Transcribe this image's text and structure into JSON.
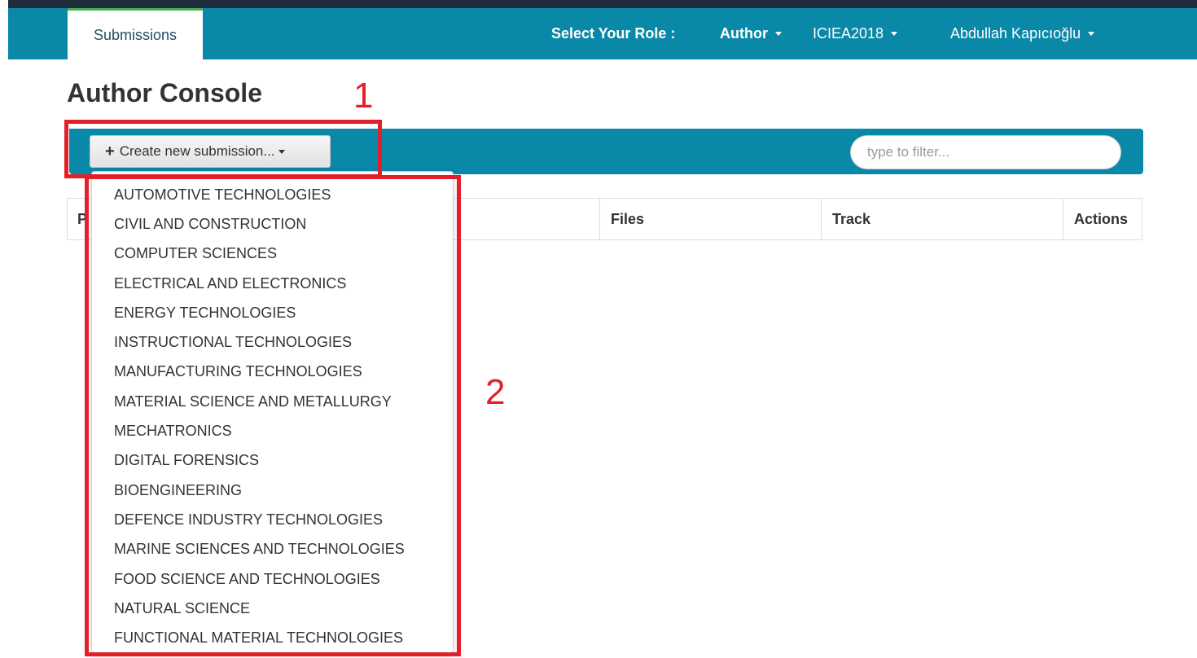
{
  "navbar": {
    "tab_label": "Submissions",
    "role_label": "Select Your Role :",
    "role_value": "Author",
    "conference": "ICIEA2018",
    "user_name": "Abdullah Kapıcıoğlu"
  },
  "page": {
    "title": "Author Console"
  },
  "toolbar": {
    "create_label": "Create new submission...",
    "filter_placeholder": "type to filter..."
  },
  "table": {
    "columns": [
      "P",
      "Files",
      "Track",
      "Actions"
    ]
  },
  "dropdown": {
    "items": [
      "AUTOMOTIVE TECHNOLOGIES",
      "CIVIL AND CONSTRUCTION",
      "COMPUTER SCIENCES",
      "ELECTRICAL AND ELECTRONICS",
      "ENERGY TECHNOLOGIES",
      "INSTRUCTIONAL TECHNOLOGIES",
      "MANUFACTURING TECHNOLOGIES",
      "MATERIAL SCIENCE AND METALLURGY",
      "MECHATRONICS",
      "DIGITAL FORENSICS",
      "BIOENGINEERING",
      "DEFENCE INDUSTRY TECHNOLOGIES",
      "MARINE SCIENCES AND TECHNOLOGIES",
      "FOOD SCIENCE AND TECHNOLOGIES",
      "NATURAL SCIENCE",
      "FUNCTIONAL MATERIAL TECHNOLOGIES"
    ]
  },
  "annotations": {
    "label_1": "1",
    "label_2": "2"
  },
  "colors": {
    "navbar": "#0a88a8",
    "annotation": "#e3202a"
  }
}
